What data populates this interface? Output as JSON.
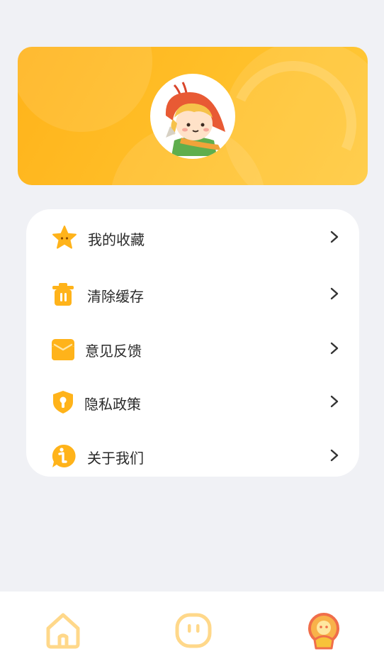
{
  "profile": {
    "avatar_icon": "cartoon-boy-avatar"
  },
  "menu": {
    "items": [
      {
        "label": "我的收藏",
        "icon": "star-icon"
      },
      {
        "label": "清除缓存",
        "icon": "trash-icon"
      },
      {
        "label": "意见反馈",
        "icon": "feedback-box-icon"
      },
      {
        "label": "隐私政策",
        "icon": "shield-icon"
      },
      {
        "label": "关于我们",
        "icon": "info-icon"
      }
    ],
    "chevron_icon": "chevron-right-icon"
  },
  "tabbar": {
    "tabs": [
      {
        "icon": "home-icon",
        "active": false
      },
      {
        "icon": "chat-face-icon",
        "active": false
      },
      {
        "icon": "profile-icon",
        "active": true
      }
    ]
  },
  "colors": {
    "accent": "#ffb31a",
    "active_tab": "#f06e4a",
    "inactive_tab": "#ffd88a",
    "background": "#f0f1f5"
  }
}
